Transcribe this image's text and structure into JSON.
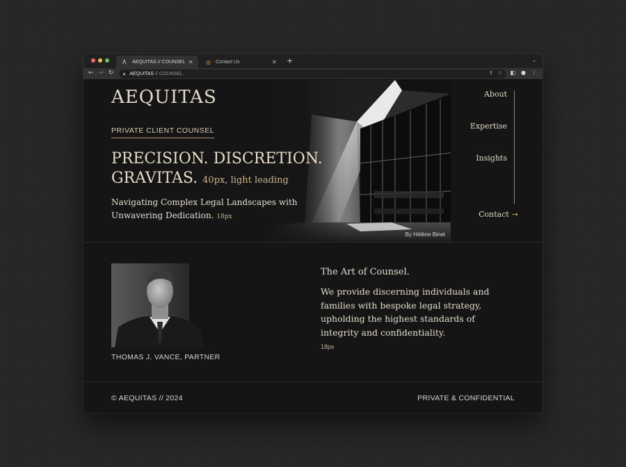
{
  "browser": {
    "tabs": [
      {
        "label": "AEQUITAS // COUNSEL",
        "favicon": "lambda-icon",
        "active": true
      },
      {
        "label": "Contact Us",
        "favicon": "globe-icon",
        "active": false
      }
    ],
    "url_host": "AEQUITAS",
    "url_path": "// COUNSEL"
  },
  "site": {
    "brand": "AEQUITAS",
    "eyebrow": "PRIVATE CLIENT COUNSEL",
    "headline": "PRECISION. DISCRETION. GRAVITAS.",
    "headline_note": "40px, light leading",
    "subhead": "Navigating Complex Legal Landscapes with Unwavering Dedication.",
    "subhead_note": "18px",
    "photo_credit": "By Hélène Binet"
  },
  "nav": {
    "about": "About",
    "expertise": "Expertise",
    "insights": "Insights",
    "contact": "Contact",
    "contact_arrow": "→"
  },
  "profile": {
    "caption": "THOMAS J. VANCE, PARTNER"
  },
  "about": {
    "title": "The Art of Counsel.",
    "body": "We provide discerning individuals and families with bespoke legal strategy, upholding the highest standards of integrity and confidentiality.",
    "note": "18px"
  },
  "footer": {
    "left": "© AEQUITAS // 2024",
    "right": "PRIVATE & CONFIDENTIAL"
  },
  "colors": {
    "accent": "#b39a6b",
    "background": "#151515",
    "text": "#e4dccb"
  }
}
